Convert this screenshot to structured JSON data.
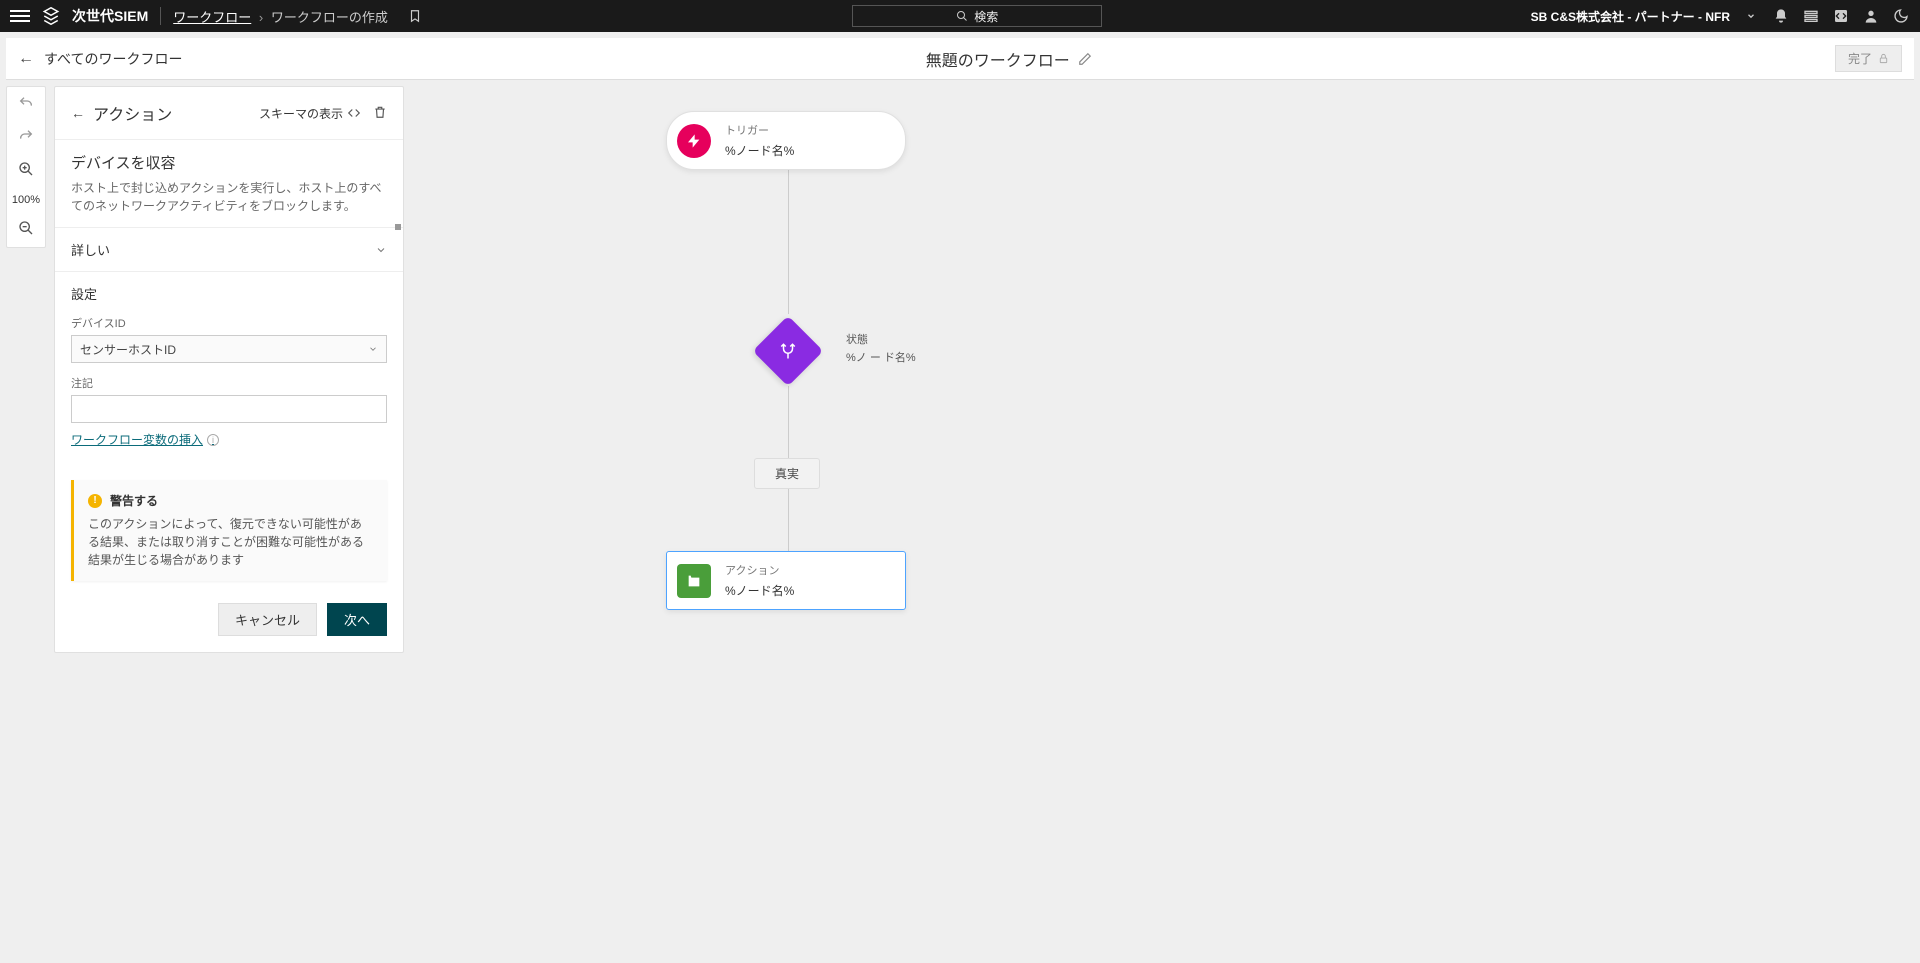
{
  "topbar": {
    "app_name": "次世代SIEM",
    "breadcrumb_link": "ワークフロー",
    "breadcrumb_current": "ワークフローの作成",
    "search_label": "検索",
    "company": "SB C&S株式会社 - パートナー - NFR"
  },
  "subheader": {
    "all_workflows": "すべてのワークフロー",
    "title": "無題のワークフロー",
    "done": "完了"
  },
  "toolstrip": {
    "zoom": "100%"
  },
  "panel": {
    "header_title": "アクション",
    "schema_label": "スキーマの表示",
    "section_title": "デバイスを収容",
    "section_desc": "ホスト上で封じ込めアクションを実行し、ホスト上のすべてのネットワークアクティビティをブロックします。",
    "accordion_label": "詳しい",
    "settings_heading": "設定",
    "field1_label": "デバイスID",
    "field1_value": "センサーホストID",
    "field2_label": "注記",
    "insert_link": "ワークフロー変数の挿入",
    "warning_title": "警告する",
    "warning_body": "このアクションによって、復元できない可能性がある結果、または取り消すことが困難な可能性がある結果が生じる場合があります",
    "btn_cancel": "キャンセル",
    "btn_next": "次へ"
  },
  "canvas": {
    "trigger_type": "トリガー",
    "trigger_name": "%ノード名%",
    "condition_type": "状態",
    "condition_name": "%ノ ー ド名%",
    "branch_true": "真実",
    "action_type": "アクション",
    "action_name": "%ノード名%"
  }
}
